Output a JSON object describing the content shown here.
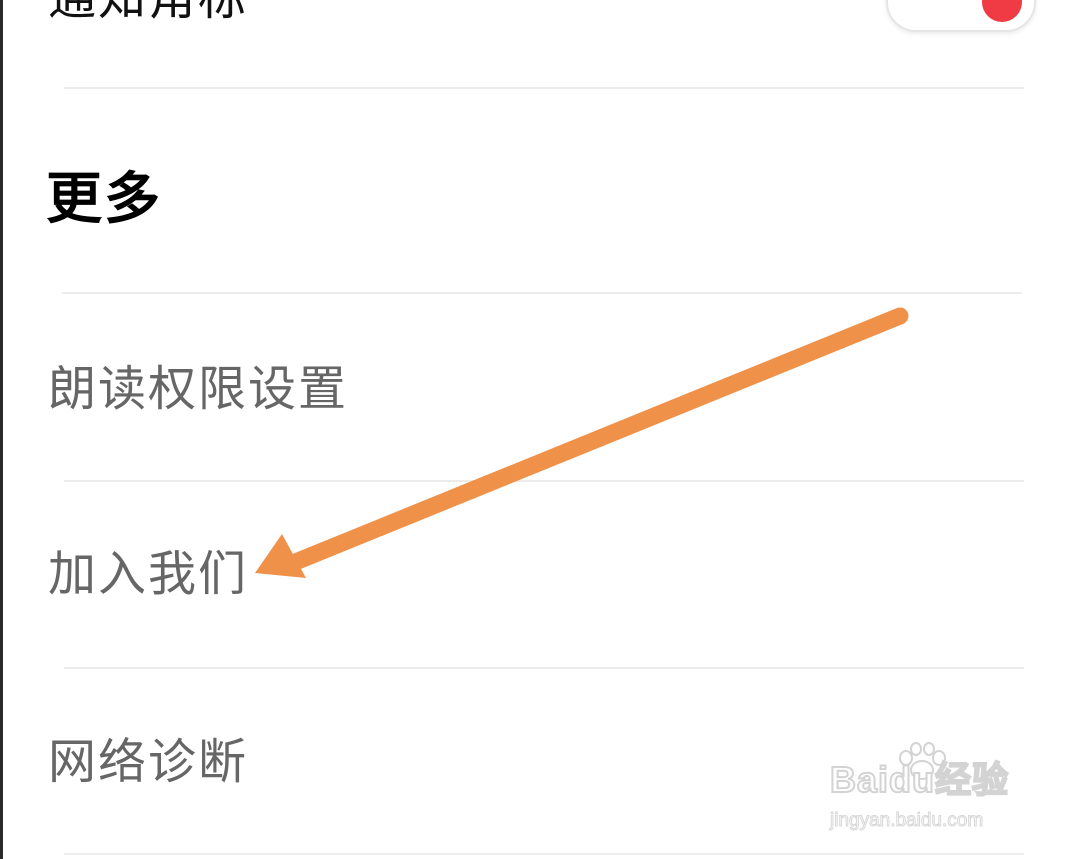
{
  "settings": {
    "partial_row": {
      "label": "通知角标",
      "toggle_on": true,
      "toggle_knob_color": "#f03a44"
    },
    "section_title": "更多",
    "items": [
      {
        "label": "朗读权限设置"
      },
      {
        "label": "加入我们"
      },
      {
        "label": "网络诊断"
      }
    ]
  },
  "annotation": {
    "arrow_color": "#f0914a",
    "arrow_icon": "arrow-pointer-icon"
  },
  "watermark": {
    "logo_text": "Baidu经验",
    "url": "jingyan.baidu.com"
  },
  "colors": {
    "background": "#ffffff",
    "item_text": "#666666",
    "section_title": "#000000",
    "divider": "#ececec"
  }
}
